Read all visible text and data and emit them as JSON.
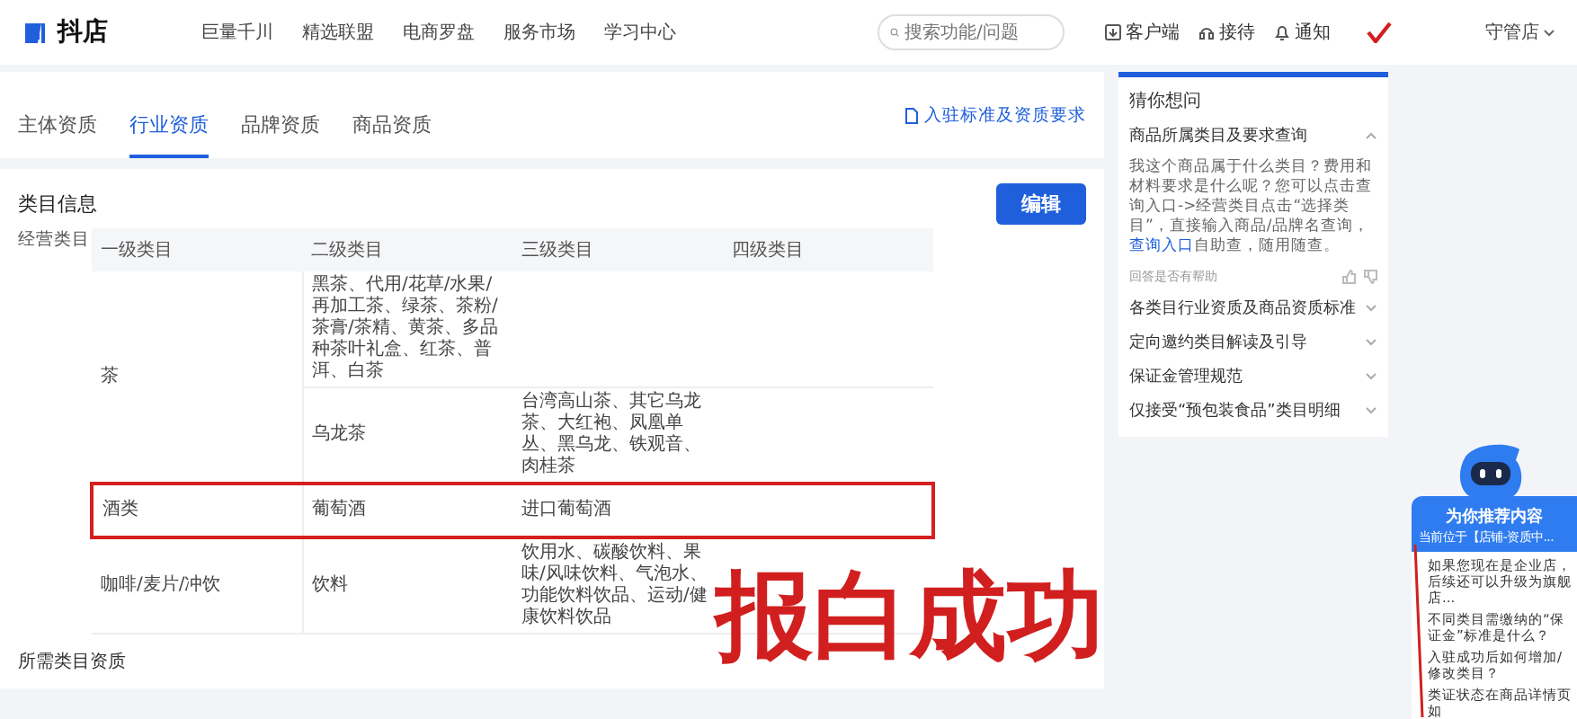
{
  "header": {
    "logo_text": "抖店",
    "nav": [
      "巨量千川",
      "精选联盟",
      "电商罗盘",
      "服务市场",
      "学习中心"
    ],
    "search": {
      "placeholder": "搜索功能/问题"
    },
    "actions": [
      {
        "kind": "download",
        "label": "客户端"
      },
      {
        "kind": "service",
        "label": "接待"
      },
      {
        "kind": "bell",
        "label": "通知"
      }
    ],
    "user": "守管店"
  },
  "tabs": [
    {
      "label": "主体资质",
      "selected": false
    },
    {
      "label": "行业资质",
      "selected": true
    },
    {
      "label": "品牌资质",
      "selected": false
    },
    {
      "label": "商品资质",
      "selected": false
    }
  ],
  "standards_link": "入驻标准及资质要求",
  "section_title": "类目信息",
  "edit_button": "编辑",
  "field_label": "经营类目",
  "table": {
    "columns": [
      "一级类目",
      "二级类目",
      "三级类目",
      "四级类目"
    ],
    "rows": [
      {
        "level_1": "茶",
        "highlighted": false,
        "items": [
          {
            "level_2": "黑茶、代用/花草/水果/再加工茶、绿茶、茶粉/茶膏/茶精、黄茶、多品种茶叶礼盒、红茶、普洱、白茶"
          },
          {
            "level_2": "乌龙茶",
            "level_3": "台湾高山茶、其它乌龙茶、大红袍、凤凰单丛、黑乌龙、铁观音、肉桂茶"
          }
        ]
      },
      {
        "level_1": "酒类",
        "highlighted": true,
        "items": [
          {
            "level_2": "葡萄酒",
            "level_3": "进口葡萄酒"
          }
        ]
      },
      {
        "level_1": "咖啡/麦片/冲饮",
        "highlighted": false,
        "items": [
          {
            "level_2": "饮料",
            "level_3": "饮用水、碳酸饮料、果味/风味饮料、气泡水、功能饮料饮品、运动/健康饮料饮品"
          }
        ]
      }
    ]
  },
  "next_section_title": "所需类目资质",
  "overlay_text": "报白成功",
  "faq": {
    "title": "猜你想问",
    "items": [
      {
        "question": "商品所属类目及要求查询",
        "expanded": true,
        "answer_before": "我这个商品属于什么类目？费用和材料要求是什么呢？您可以点击查询入口->经营类目点击“选择类目”，直接输入商品/品牌名查询，",
        "answer_link": "查询入口",
        "answer_after": "自助查，随用随查。",
        "feedback": "回答是否有帮助"
      },
      {
        "question": "各类目行业资质及商品资质标准",
        "expanded": false
      },
      {
        "question": "定向邀约类目解读及引导",
        "expanded": false
      },
      {
        "question": "保证金管理规范",
        "expanded": false
      },
      {
        "question": "仅接受“预包装食品”类目明细",
        "expanded": false
      }
    ]
  },
  "assistant": {
    "title": "为你推荐内容",
    "subtitle": "当前位于【店铺-资质中...",
    "items": [
      "如果您现在是企业店，后续还可以升级为旗舰店...",
      "不同类目需缴纳的“保证金”标准是什么？",
      "入驻成功后如何增加/修改类目？",
      "类证状态在商品详情页如"
    ]
  }
}
